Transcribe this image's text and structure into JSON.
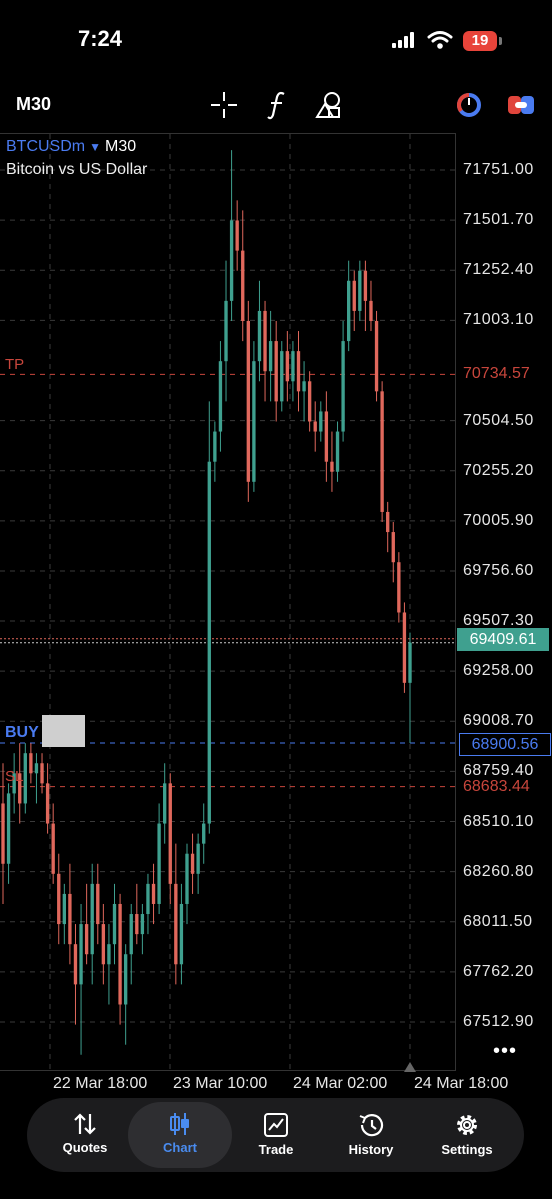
{
  "status_bar": {
    "time": "7:24",
    "battery": "19"
  },
  "toolbar": {
    "timeframe": "M30",
    "icons": [
      "crosshair-icon",
      "function-icon",
      "shapes-icon",
      "trading-signals-icon",
      "one-click-trading-icon"
    ]
  },
  "chart_header": {
    "symbol": "BTCUSDm",
    "arrow": "▼",
    "timeframe": "M30",
    "description": "Bitcoin vs US Dollar"
  },
  "price_axis": [
    "71751.00",
    "71501.70",
    "71252.40",
    "71003.10",
    "70504.50",
    "70255.20",
    "70005.90",
    "69756.60",
    "69507.30",
    "69258.00",
    "69008.70",
    "68759.40",
    "68510.10",
    "68260.80",
    "68011.50",
    "67762.20",
    "67512.90"
  ],
  "time_axis": [
    "22 Mar 18:00",
    "23 Mar 10:00",
    "24 Mar 02:00",
    "24 Mar 18:00"
  ],
  "levels": {
    "tp": {
      "label": "TP",
      "price": "70734.57",
      "color": "#c8463c"
    },
    "bid": {
      "price": "69409.61",
      "color": "#3fa08f"
    },
    "buy": {
      "label": "BUY",
      "price": "68900.56",
      "color": "#4a7bf0"
    },
    "sl": {
      "label": "SL",
      "price": "68683.44",
      "color": "#c8463c"
    }
  },
  "colors": {
    "bull": "#3fa08f",
    "bear": "#e0685c",
    "grid": "#3a3a3a"
  },
  "chart_data": {
    "type": "candlestick",
    "symbol": "BTCUSDm",
    "timeframe": "M30",
    "ylim": [
      67400,
      71900
    ],
    "candles": [
      {
        "o": 68600,
        "h": 68800,
        "l": 68100,
        "c": 68300
      },
      {
        "o": 68300,
        "h": 68700,
        "l": 68200,
        "c": 68650
      },
      {
        "o": 68650,
        "h": 68850,
        "l": 68550,
        "c": 68750
      },
      {
        "o": 68750,
        "h": 68900,
        "l": 68500,
        "c": 68600
      },
      {
        "o": 68600,
        "h": 68900,
        "l": 68550,
        "c": 68850
      },
      {
        "o": 68850,
        "h": 68900,
        "l": 68700,
        "c": 68750
      },
      {
        "o": 68750,
        "h": 68850,
        "l": 68600,
        "c": 68800
      },
      {
        "o": 68800,
        "h": 68850,
        "l": 68650,
        "c": 68700
      },
      {
        "o": 68700,
        "h": 68800,
        "l": 68450,
        "c": 68500
      },
      {
        "o": 68500,
        "h": 68600,
        "l": 68200,
        "c": 68250
      },
      {
        "o": 68250,
        "h": 68350,
        "l": 67900,
        "c": 68000
      },
      {
        "o": 68000,
        "h": 68200,
        "l": 67900,
        "c": 68150
      },
      {
        "o": 68150,
        "h": 68300,
        "l": 67800,
        "c": 67900
      },
      {
        "o": 67900,
        "h": 68000,
        "l": 67500,
        "c": 67700
      },
      {
        "o": 67700,
        "h": 68100,
        "l": 67350,
        "c": 68000
      },
      {
        "o": 68000,
        "h": 68200,
        "l": 67800,
        "c": 67850
      },
      {
        "o": 67850,
        "h": 68300,
        "l": 67700,
        "c": 68200
      },
      {
        "o": 68200,
        "h": 68300,
        "l": 67900,
        "c": 68000
      },
      {
        "o": 68000,
        "h": 68100,
        "l": 67700,
        "c": 67800
      },
      {
        "o": 67800,
        "h": 68000,
        "l": 67600,
        "c": 67900
      },
      {
        "o": 67900,
        "h": 68200,
        "l": 67800,
        "c": 68100
      },
      {
        "o": 68100,
        "h": 68150,
        "l": 67500,
        "c": 67600
      },
      {
        "o": 67600,
        "h": 67900,
        "l": 67400,
        "c": 67850
      },
      {
        "o": 67850,
        "h": 68100,
        "l": 67700,
        "c": 68050
      },
      {
        "o": 68050,
        "h": 68200,
        "l": 67900,
        "c": 67950
      },
      {
        "o": 67950,
        "h": 68100,
        "l": 67850,
        "c": 68050
      },
      {
        "o": 68050,
        "h": 68250,
        "l": 67950,
        "c": 68200
      },
      {
        "o": 68200,
        "h": 68300,
        "l": 68000,
        "c": 68100
      },
      {
        "o": 68100,
        "h": 68600,
        "l": 68050,
        "c": 68500
      },
      {
        "o": 68500,
        "h": 68800,
        "l": 68400,
        "c": 68700
      },
      {
        "o": 68700,
        "h": 68750,
        "l": 68100,
        "c": 68200
      },
      {
        "o": 68200,
        "h": 68400,
        "l": 67700,
        "c": 67800
      },
      {
        "o": 67800,
        "h": 68200,
        "l": 67700,
        "c": 68100
      },
      {
        "o": 68100,
        "h": 68400,
        "l": 68000,
        "c": 68350
      },
      {
        "o": 68350,
        "h": 68450,
        "l": 68150,
        "c": 68250
      },
      {
        "o": 68250,
        "h": 68450,
        "l": 68150,
        "c": 68400
      },
      {
        "o": 68400,
        "h": 68600,
        "l": 68300,
        "c": 68500
      },
      {
        "o": 68500,
        "h": 70600,
        "l": 68450,
        "c": 70300
      },
      {
        "o": 70300,
        "h": 70500,
        "l": 70200,
        "c": 70450
      },
      {
        "o": 70450,
        "h": 70900,
        "l": 70350,
        "c": 70800
      },
      {
        "o": 70800,
        "h": 71300,
        "l": 70600,
        "c": 71100
      },
      {
        "o": 71100,
        "h": 71850,
        "l": 71000,
        "c": 71500
      },
      {
        "o": 71500,
        "h": 71600,
        "l": 71250,
        "c": 71350
      },
      {
        "o": 71350,
        "h": 71550,
        "l": 70900,
        "c": 71000
      },
      {
        "o": 71000,
        "h": 71100,
        "l": 70100,
        "c": 70200
      },
      {
        "o": 70200,
        "h": 70900,
        "l": 70150,
        "c": 70800
      },
      {
        "o": 70800,
        "h": 71200,
        "l": 70700,
        "c": 71050
      },
      {
        "o": 71050,
        "h": 71100,
        "l": 70600,
        "c": 70750
      },
      {
        "o": 70750,
        "h": 71050,
        "l": 70600,
        "c": 70900
      },
      {
        "o": 70900,
        "h": 71000,
        "l": 70500,
        "c": 70600
      },
      {
        "o": 70600,
        "h": 70900,
        "l": 70550,
        "c": 70850
      },
      {
        "o": 70850,
        "h": 70950,
        "l": 70600,
        "c": 70700
      },
      {
        "o": 70700,
        "h": 70900,
        "l": 70600,
        "c": 70850
      },
      {
        "o": 70850,
        "h": 70950,
        "l": 70550,
        "c": 70650
      },
      {
        "o": 70650,
        "h": 70800,
        "l": 70500,
        "c": 70700
      },
      {
        "o": 70700,
        "h": 70750,
        "l": 70450,
        "c": 70500
      },
      {
        "o": 70500,
        "h": 70600,
        "l": 70350,
        "c": 70450
      },
      {
        "o": 70450,
        "h": 70600,
        "l": 70400,
        "c": 70550
      },
      {
        "o": 70550,
        "h": 70650,
        "l": 70200,
        "c": 70300
      },
      {
        "o": 70300,
        "h": 70450,
        "l": 70150,
        "c": 70250
      },
      {
        "o": 70250,
        "h": 70500,
        "l": 70200,
        "c": 70450
      },
      {
        "o": 70450,
        "h": 71000,
        "l": 70400,
        "c": 70900
      },
      {
        "o": 70900,
        "h": 71300,
        "l": 70850,
        "c": 71200
      },
      {
        "o": 71200,
        "h": 71250,
        "l": 70950,
        "c": 71050
      },
      {
        "o": 71050,
        "h": 71300,
        "l": 71000,
        "c": 71250
      },
      {
        "o": 71250,
        "h": 71300,
        "l": 70950,
        "c": 71100
      },
      {
        "o": 71100,
        "h": 71200,
        "l": 70950,
        "c": 71000
      },
      {
        "o": 71000,
        "h": 71050,
        "l": 70600,
        "c": 70650
      },
      {
        "o": 70650,
        "h": 70700,
        "l": 70000,
        "c": 70050
      },
      {
        "o": 70050,
        "h": 70100,
        "l": 69850,
        "c": 69950
      },
      {
        "o": 69950,
        "h": 70000,
        "l": 69700,
        "c": 69800
      },
      {
        "o": 69800,
        "h": 69850,
        "l": 69500,
        "c": 69550
      },
      {
        "o": 69550,
        "h": 69600,
        "l": 69150,
        "c": 69200
      },
      {
        "o": 69200,
        "h": 69450,
        "l": 68900,
        "c": 69400
      }
    ]
  }
}
